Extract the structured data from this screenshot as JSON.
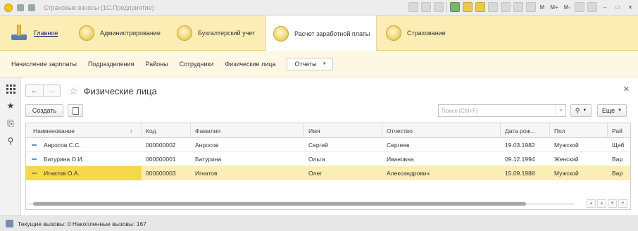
{
  "window": {
    "title": "Страховые взносы (1С:Предприятие)",
    "toolbar_text_buttons": [
      "M",
      "M+",
      "M-"
    ]
  },
  "sections": [
    {
      "label": "Главное",
      "icon": "home-icon"
    },
    {
      "label": "Администрирование",
      "icon": "section-icon"
    },
    {
      "label": "Бухгалтерский учет",
      "icon": "section-icon"
    },
    {
      "label": "Расчет заработной платы",
      "icon": "section-icon",
      "active": true
    },
    {
      "label": "Страхование",
      "icon": "section-icon"
    }
  ],
  "functions": {
    "items": [
      "Начисление зарплаты",
      "Подразделения",
      "Районы",
      "Сотрудники",
      "Физические лица"
    ],
    "reports_label": "Отчеты"
  },
  "form": {
    "title": "Физические лица",
    "create_label": "Создать",
    "search_placeholder": "Поиск (Ctrl+F)",
    "more_label": "Еще"
  },
  "table": {
    "columns": [
      "Наименование",
      "Код",
      "Фамилия",
      "Имя",
      "Отчество",
      "Дата рож...",
      "Пол",
      "Рай"
    ],
    "rows": [
      [
        "Анросов С.С.",
        "000000002",
        "Анросов",
        "Сергей",
        "Сергеев",
        "19.03.1982",
        "Мужской",
        "Щеб"
      ],
      [
        "Батурина О.И.",
        "000000001",
        "Батурина",
        "Ольга",
        "Ивановна",
        "09.12.1994",
        "Женский",
        "Вар"
      ],
      [
        "Игнатов О.А.",
        "000000003",
        "Игнатов",
        "Олег",
        "Александрович",
        "15.09.1988",
        "Мужской",
        "Вар"
      ]
    ],
    "selected_row": 2,
    "sort_column": "Наименование"
  },
  "status": {
    "text": "Текущие вызовы: 0   Накопленные вызовы: 167"
  },
  "colors": {
    "sections_bg": "#fbedb3",
    "selected_row": "#fbedb3",
    "selected_cell": "#f5d94a"
  }
}
